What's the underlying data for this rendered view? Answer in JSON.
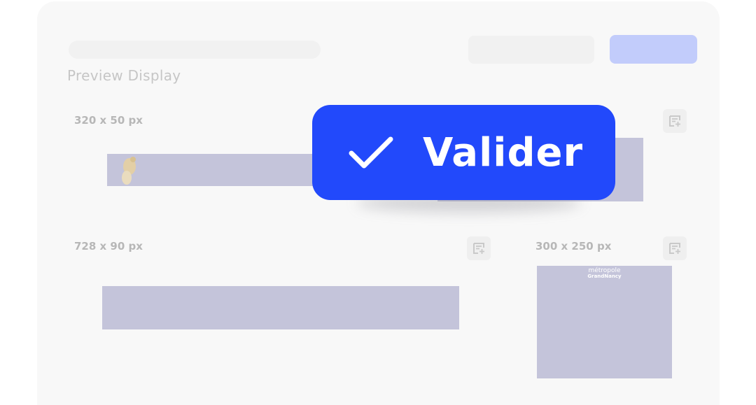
{
  "header": {
    "section_title": "Preview Display"
  },
  "previews": [
    {
      "size_label": "320 x 50 px"
    },
    {
      "size_label": "728 x 90 px"
    },
    {
      "size_label": "300 x 250 px"
    }
  ],
  "ad_300x250": {
    "logo_line1": "métropole",
    "logo_line2": "GrandNancy"
  },
  "validate_button": {
    "label": "Valider"
  },
  "colors": {
    "accent": "#2249fb",
    "primary_button_faded": "#c2ccfb",
    "ad_placeholder": "#c4c4da",
    "card_background": "#f8f8f8"
  },
  "icons": {
    "note_add": "note-add-icon",
    "check": "check-icon"
  }
}
